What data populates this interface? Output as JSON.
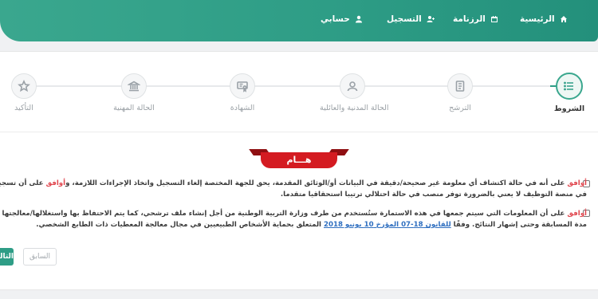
{
  "nav": {
    "home": "الرئيسية",
    "program": "الرزنامة",
    "register": "التسجيل",
    "account": "حسابي"
  },
  "steps": [
    {
      "label": "الشروط",
      "icon": "list-icon",
      "active": true
    },
    {
      "label": "الترشح",
      "icon": "document-icon",
      "active": false
    },
    {
      "label": "الحالة المدنية والعائلية",
      "icon": "user-icon",
      "active": false
    },
    {
      "label": "الشهادة",
      "icon": "certificate-icon",
      "active": false
    },
    {
      "label": "الحالة المهنية",
      "icon": "bank-icon",
      "active": false
    },
    {
      "label": "التأكيد",
      "icon": "star-icon",
      "active": false
    }
  ],
  "banner": "هـــام",
  "terms": {
    "t1_agree": "أوافق",
    "t1_text_a": " على أنه في حالة اكتشاف أي معلومة غير صحيحة/دقيقة في البيانات أو/الوثائق المقدمة، يحق للجهة المختصة إلغاء التسجيل واتخاذ الإجراءات اللازمة، و",
    "t1_agree2": "أوافق",
    "t1_text_b": " على أن تسجيلي في منصة التوظيف لا يعني بالضرورة توفر منصب في حالة احتلالي ترتيبا استحقاقيا متقدما.",
    "t2_agree": "أوافق",
    "t2_text_a": " على أن المعلومات التي سيتم جمعها في هذه الاستمارة ستُستخدم من طرف وزارة التربية الوطنية من أجل إنشاء ملف ترشحي، كما يتم الاحتفاظ بها واستغلالها/معالجتها طيلة مدة المسابقة وحتى إشهار النتائج. وفقًا ",
    "t2_link": "للقانون 18-07 المؤرخ 10 يونيو 2018",
    "t2_text_b": " المتعلق بحماية الأشخاص الطبيعيين في مجال معالجة المعطيات ذات الطابع الشخصي."
  },
  "buttons": {
    "prev": "السابق",
    "next": "التالي"
  }
}
